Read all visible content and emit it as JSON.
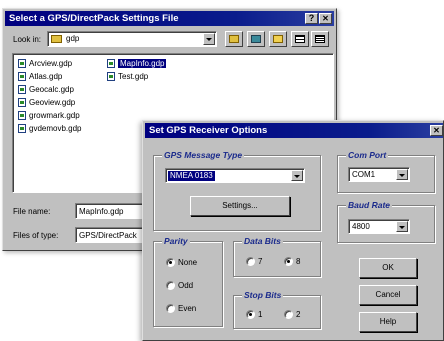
{
  "file_dialog": {
    "title": "Select a GPS/DirectPack Settings File",
    "help_button": "?",
    "close_button": "✕",
    "look_in_label": "Look in:",
    "look_in_value": "gdp",
    "files_col1": [
      "Arcview.gdp",
      "Atlas.gdp",
      "Geocalc.gdp",
      "Geoview.gdp",
      "growmark.gdp",
      "gvdemovb.gdp"
    ],
    "files_col2": [
      "MapInfo.gdp",
      "Test.gdp"
    ],
    "file_name_label": "File name:",
    "file_name_value": "MapInfo.gdp",
    "files_of_type_label": "Files of type:",
    "files_of_type_value": "GPS/DirectPack"
  },
  "gps_dialog": {
    "title": "Set GPS Receiver Options",
    "close_button": "✕",
    "message_type": {
      "title": "GPS Message Type",
      "value": "NMEA 0183",
      "settings_button": "Settings..."
    },
    "com_port": {
      "title": "Com Port",
      "value": "COM1"
    },
    "baud_rate": {
      "title": "Baud Rate",
      "value": "4800"
    },
    "parity": {
      "title": "Parity",
      "options": [
        "None",
        "Odd",
        "Even"
      ],
      "selected": "None"
    },
    "data_bits": {
      "title": "Data Bits",
      "options": [
        "7",
        "8"
      ],
      "selected": "8"
    },
    "stop_bits": {
      "title": "Stop Bits",
      "options": [
        "1",
        "2"
      ],
      "selected": "1"
    },
    "ok_button": "OK",
    "cancel_button": "Cancel",
    "help_button": "Help"
  }
}
